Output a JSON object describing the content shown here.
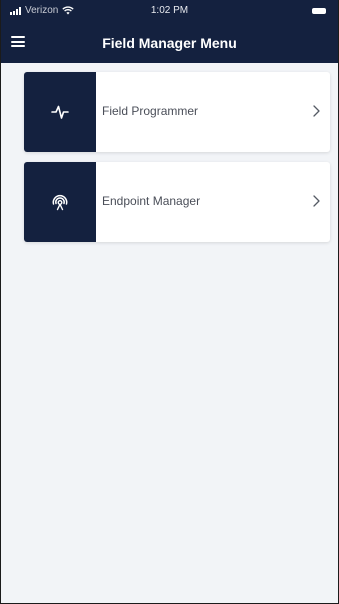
{
  "status_bar": {
    "carrier": "Verizon",
    "time": "1:02 PM",
    "icons": [
      "signal-icon",
      "wifi-icon",
      "battery-icon"
    ]
  },
  "navbar": {
    "title": "Field Manager Menu",
    "menu_icon": "hamburger-menu-icon"
  },
  "menu": {
    "items": [
      {
        "label": "Field Programmer",
        "icon": "pulse-icon"
      },
      {
        "label": "Endpoint Manager",
        "icon": "broadcast-icon"
      }
    ]
  },
  "colors": {
    "header_bg": "#14213f",
    "tile_bg": "#14213f",
    "content_bg": "#f2f4f7",
    "card_bg": "#ffffff",
    "label_text": "#4a4e58"
  }
}
